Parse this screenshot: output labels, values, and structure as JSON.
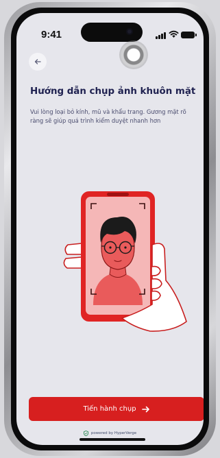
{
  "status_bar": {
    "time": "9:41"
  },
  "header": {
    "title": "Hướng dẫn chụp ảnh khuôn mặt",
    "description": "Vui lòng loại bỏ kính, mũ và khẩu trang. Gương mặt rõ ràng sẽ giúp quá trình kiểm duyệt nhanh hơn"
  },
  "actions": {
    "primary_label": "Tiến hành chụp"
  },
  "footer": {
    "powered_by": "powered by HyperVerge"
  },
  "icons": {
    "back": "arrow-left-icon",
    "primary_arrow": "arrow-right-icon",
    "shield": "shield-check-icon"
  },
  "colors": {
    "primary": "#d71f1f",
    "title": "#1f2150",
    "background": "#e6e6ec"
  }
}
